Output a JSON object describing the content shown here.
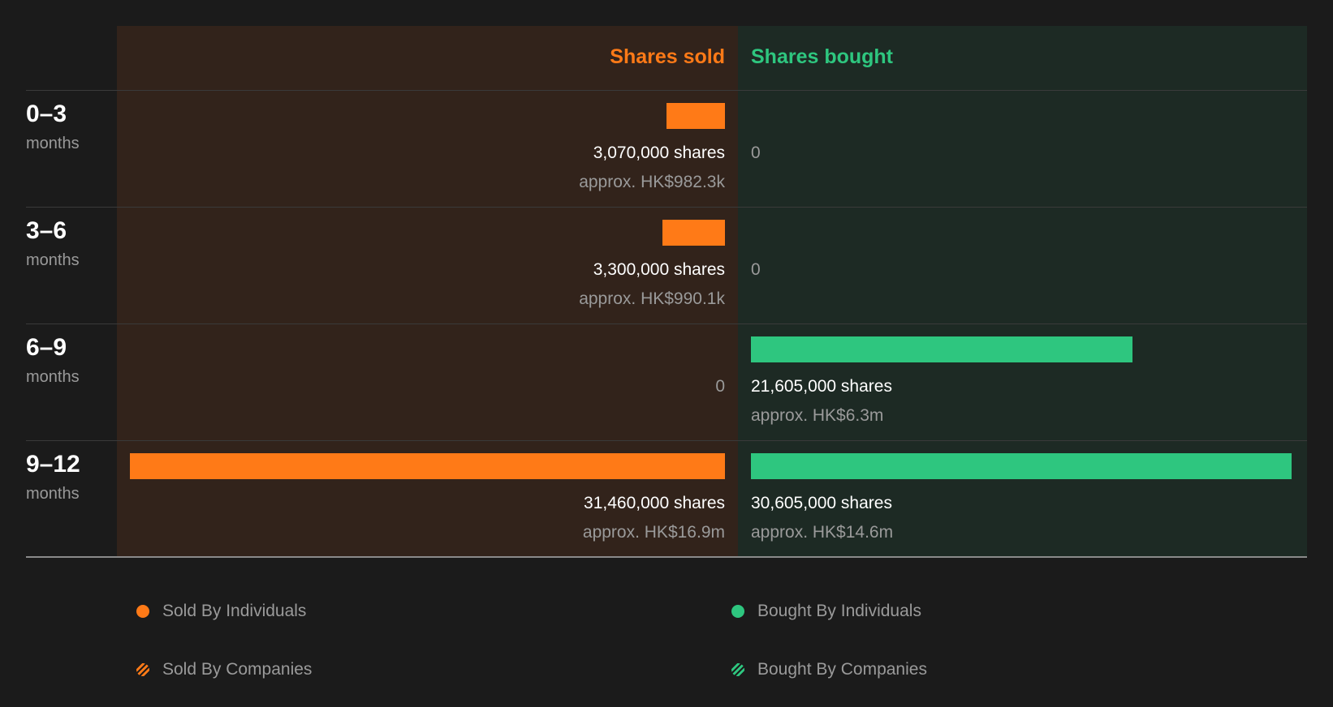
{
  "colors": {
    "sold": "#ff7a17",
    "bought": "#2ec67f",
    "stripe_dark": "#1b1b1b"
  },
  "headers": {
    "sold": "Shares sold",
    "bought": "Shares bought"
  },
  "chart_data": {
    "type": "bar",
    "title": "",
    "xlabel": "",
    "ylabel": "",
    "categories": [
      "0–3 months",
      "3–6 months",
      "6–9 months",
      "9–12 months"
    ],
    "series": [
      {
        "name": "Shares sold",
        "values": [
          3070000,
          3300000,
          0,
          31460000
        ]
      },
      {
        "name": "Shares bought",
        "values": [
          0,
          0,
          21605000,
          30605000
        ]
      }
    ]
  },
  "rows": [
    {
      "range": "0–3",
      "unit": "months",
      "sold": {
        "shares": "3,070,000 shares",
        "approx": "approx. HK$982.3k"
      },
      "bought": {
        "zero": "0"
      }
    },
    {
      "range": "3–6",
      "unit": "months",
      "sold": {
        "shares": "3,300,000 shares",
        "approx": "approx. HK$990.1k"
      },
      "bought": {
        "zero": "0"
      }
    },
    {
      "range": "6–9",
      "unit": "months",
      "sold": {
        "zero": "0"
      },
      "bought": {
        "shares": "21,605,000 shares",
        "approx": "approx. HK$6.3m"
      }
    },
    {
      "range": "9–12",
      "unit": "months",
      "sold": {
        "shares": "31,460,000 shares",
        "approx": "approx. HK$16.9m"
      },
      "bought": {
        "shares": "30,605,000 shares",
        "approx": "approx. HK$14.6m"
      }
    }
  ],
  "legend": {
    "sold_individuals": "Sold By Individuals",
    "sold_companies": "Sold By Companies",
    "bought_individuals": "Bought By Individuals",
    "bought_companies": "Bought By Companies"
  }
}
